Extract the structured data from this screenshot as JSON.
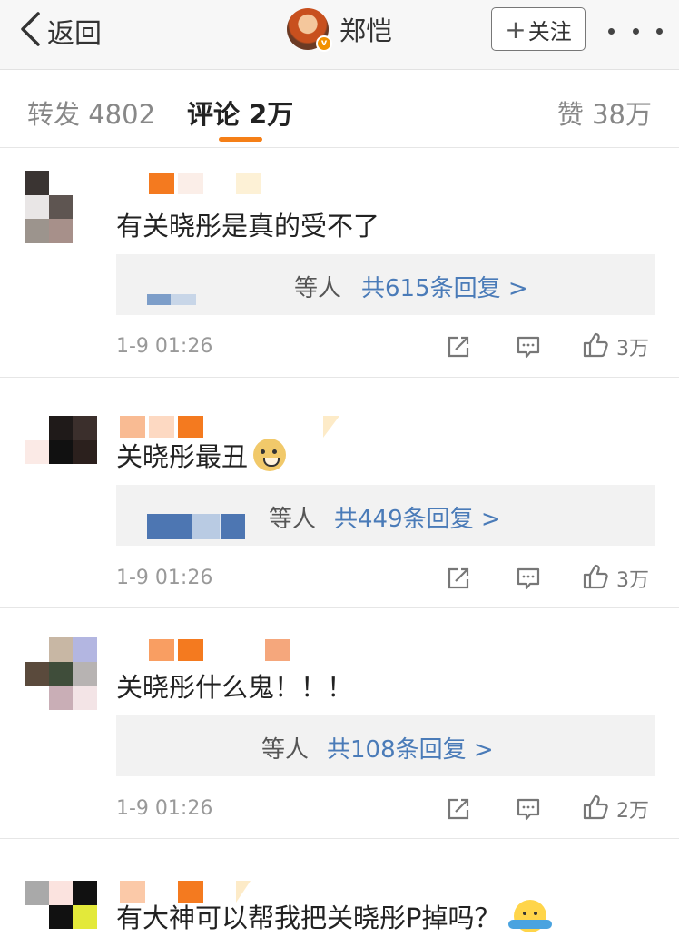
{
  "header": {
    "back_label": "返回",
    "user_name": "郑恺",
    "verified_badge": "v",
    "follow_label": "关注",
    "follow_plus": "+"
  },
  "tabs": {
    "repost": "转发 4802",
    "comments": "评论 2万",
    "likes": "赞 38万"
  },
  "colors": {
    "accent": "#f57f17",
    "link": "#4a7bb8",
    "reply_box": "#f2f2f2"
  },
  "comments": [
    {
      "text": "有关晓彤是真的受不了",
      "emoji": "",
      "reply_who": "等人",
      "reply_count": "共615条回复 >",
      "time": "1-9 01:26",
      "likes": "3万"
    },
    {
      "text": "关晓彤最丑",
      "emoji": "doge",
      "reply_who": "等人",
      "reply_count": "共449条回复 >",
      "time": "1-9 01:26",
      "likes": "3万"
    },
    {
      "text": "关晓彤什么鬼！！！",
      "emoji": "",
      "reply_who": "等人",
      "reply_count": "共108条回复 >",
      "time": "1-9 01:26",
      "likes": "2万"
    },
    {
      "text": "有大神可以帮我把关晓彤P掉吗？",
      "emoji": "shrug"
    }
  ],
  "icons": [
    "chevron-left-icon",
    "more-dots-icon",
    "share-icon",
    "reply-icon",
    "like-icon",
    "doge-emoji-icon",
    "shrug-emoji-icon"
  ]
}
